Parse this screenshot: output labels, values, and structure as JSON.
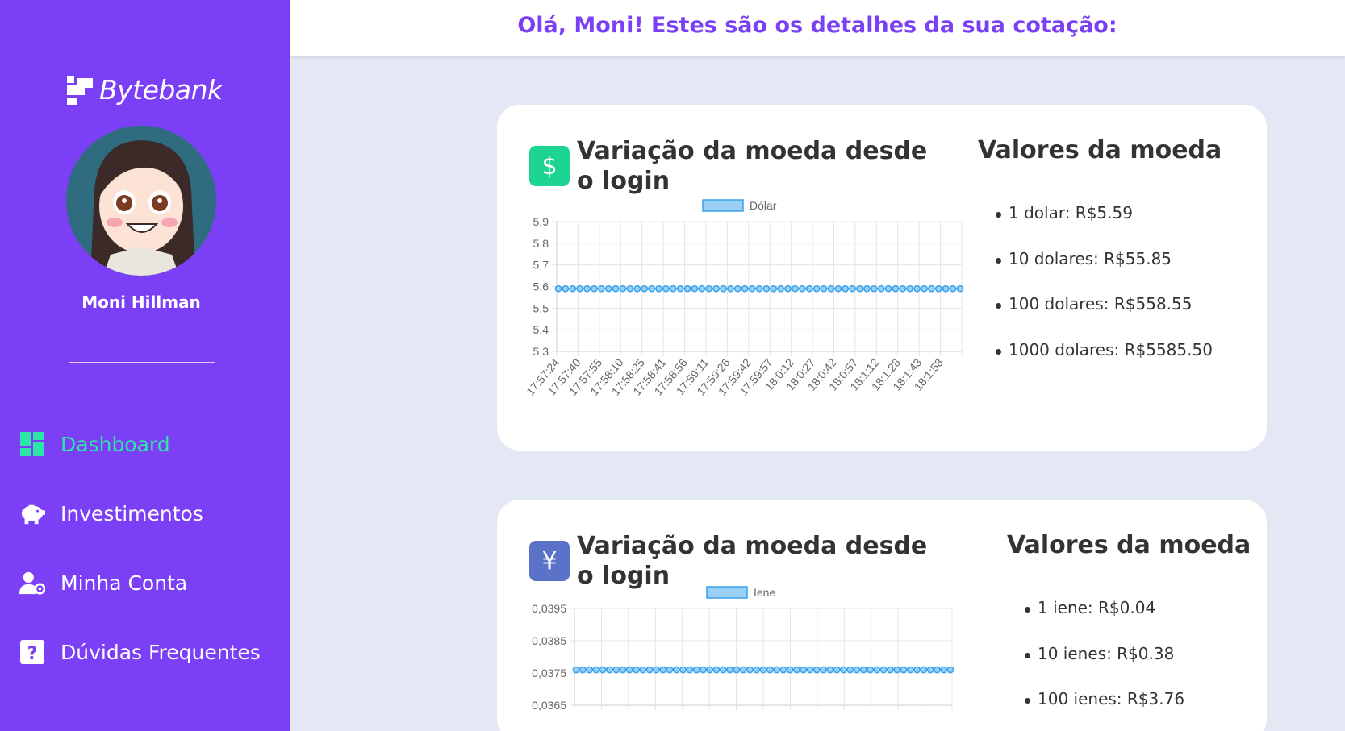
{
  "app": {
    "brand": "Bytebank"
  },
  "user": {
    "name": "Moni Hillman"
  },
  "header": {
    "greeting": "Olá, Moni! Estes são os detalhes da sua cotação:"
  },
  "nav": [
    {
      "label": "Dashboard",
      "icon": "dashboard-icon",
      "active": true
    },
    {
      "label": "Investimentos",
      "icon": "piggy-bank-icon",
      "active": false
    },
    {
      "label": "Minha Conta",
      "icon": "user-settings-icon",
      "active": false
    },
    {
      "label": "Dúvidas Frequentes",
      "icon": "question-icon",
      "active": false
    }
  ],
  "colors": {
    "sidebar": "#7b3ff6",
    "accent": "#2ee6a8",
    "dollar_icon": "#1ed493",
    "yen_icon": "#5a72c8",
    "line": "#36a2eb",
    "fill": "#9ad0f5"
  },
  "cards": [
    {
      "icon": "dollar-icon",
      "icon_glyph": "$",
      "title": "Variação da moeda desde o login",
      "values_title": "Valores da moeda",
      "values": [
        "1 dolar: R$5.59",
        "10 dolares: R$55.85",
        "100 dolares: R$558.55",
        "1000 dolares: R$5585.50"
      ]
    },
    {
      "icon": "yen-icon",
      "icon_glyph": "¥",
      "title": "Variação da moeda desde o login",
      "values_title": "Valores da moeda",
      "values": [
        "1 iene: R$0.04",
        "10 ienes: R$0.38",
        "100 ienes: R$3.76"
      ]
    }
  ],
  "chart_data": [
    {
      "type": "line",
      "series": [
        {
          "name": "Dólar",
          "constant_value": 5.59
        }
      ],
      "point_count": 57,
      "yticks": [
        "5,9",
        "5,8",
        "5,7",
        "5,6",
        "5,5",
        "5,4",
        "5,3"
      ],
      "ylim": [
        5.3,
        5.9
      ],
      "x_labels": [
        "17:57:24",
        "17:57:40",
        "17:57:55",
        "17:58:10",
        "17:58:25",
        "17:58:41",
        "17:58:56",
        "17:59:11",
        "17:59:26",
        "17:59:42",
        "17:59:57",
        "18:0:12",
        "18:0:27",
        "18:0:42",
        "18:0:57",
        "18:1:12",
        "18:1:28",
        "18:1:43",
        "18:1:58"
      ],
      "grid": true,
      "legend": "top-center"
    },
    {
      "type": "line",
      "series": [
        {
          "name": "Iene",
          "constant_value": 0.0376
        }
      ],
      "point_count": 57,
      "yticks": [
        "0,0395",
        "0,0385",
        "0,0375",
        "0,0365"
      ],
      "ylim": [
        0.0365,
        0.0395
      ],
      "grid": true,
      "legend": "top-center"
    }
  ]
}
